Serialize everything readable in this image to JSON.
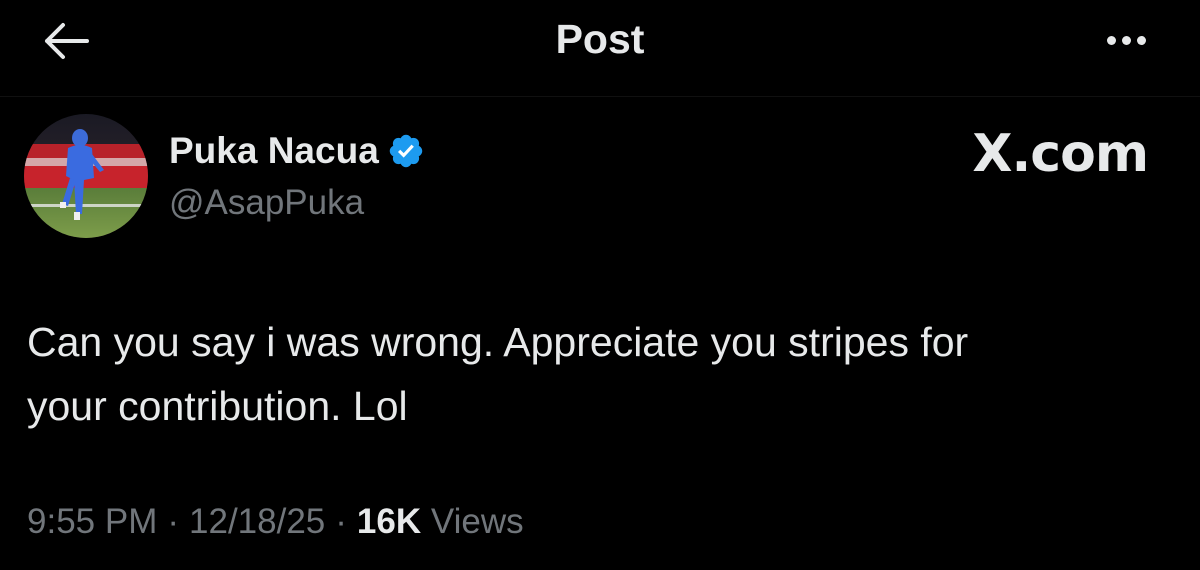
{
  "header": {
    "title": "Post",
    "back_icon": "arrow-left-icon",
    "more_icon": "more-horizontal-icon"
  },
  "author": {
    "display_name": "Puka Nacua",
    "handle": "@AsapPuka",
    "verified": true,
    "verified_color": "#1d9bf0"
  },
  "watermark": "X.com",
  "post": {
    "text": "Can you say i was wrong. Appreciate you stripes for\nyour contribution. Lol"
  },
  "meta": {
    "time": "9:55 PM",
    "date": "12/18/25",
    "separator": "·",
    "views_count": "16K",
    "views_label": "Views"
  },
  "colors": {
    "background": "#000000",
    "primary_text": "#e7e9ea",
    "secondary_text": "#71767b",
    "accent": "#1d9bf0"
  }
}
